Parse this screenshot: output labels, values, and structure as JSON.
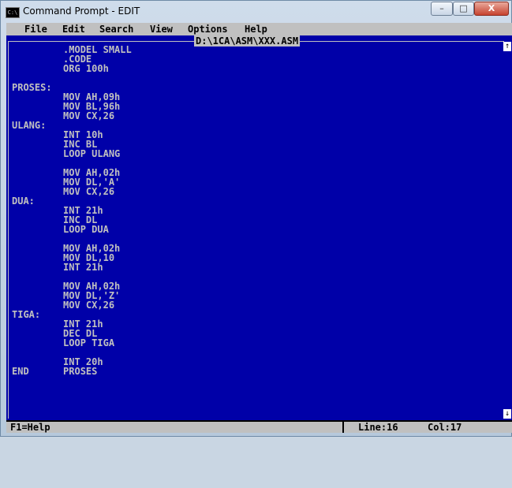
{
  "window": {
    "title": "Command Prompt - EDIT",
    "icon_text": "C:\\",
    "minimize_label": "–",
    "maximize_label": "□",
    "close_label": "X"
  },
  "menu": {
    "items": [
      "File",
      "Edit",
      "Search",
      "View",
      "Options",
      "Help"
    ]
  },
  "editor": {
    "file_path": "D:\\1CA\\ASM\\XXX.ASM",
    "lines": [
      "         .MODEL SMALL",
      "         .CODE",
      "         ORG 100h",
      "",
      "PROSES:",
      "         MOV AH,09h",
      "         MOV BL,96h",
      "         MOV CX,26",
      "ULANG:",
      "         INT 10h",
      "         INC BL",
      "         LOOP ULANG",
      "",
      "         MOV AH,02h",
      "         MOV DL,'A'",
      "         MOV CX,26",
      "DUA:",
      "         INT 21h",
      "         INC DL",
      "         LOOP DUA",
      "",
      "         MOV AH,02h",
      "         MOV DL,10",
      "         INT 21h",
      "",
      "         MOV AH,02h",
      "         MOV DL,'Z'",
      "         MOV CX,26",
      "TIGA:",
      "         INT 21h",
      "         DEC DL",
      "         LOOP TIGA",
      "",
      "         INT 20h",
      "END      PROSES"
    ],
    "scroll_up_icon": "↑",
    "scroll_down_icon": "↓"
  },
  "status": {
    "help": "F1=Help",
    "line": "Line:16",
    "col": "Col:17"
  },
  "colors": {
    "background": "#0000a8",
    "text": "#c0c0c0",
    "bars": "#c0c0c0"
  }
}
